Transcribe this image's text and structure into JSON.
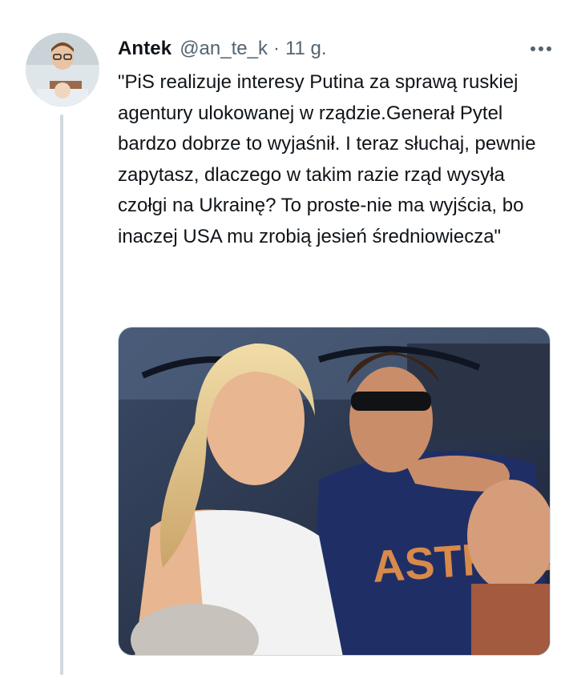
{
  "tweet": {
    "author_name": "Antek",
    "author_handle": "@an_te_k",
    "separator": "·",
    "timestamp": "11 g.",
    "text": "\"PiS realizuje interesy Putina za sprawą ruskiej agentury ulokowanej w rządzie.Generał Pytel bardzo dobrze to wyjaśnił. I teraz słuchaj, pewnie zapytasz, dlaczego w takim razie rząd wysyła czołgi na Ukrainę? To proste-nie ma wyjścia, bo inaczej USA mu zrobią jesień średniowiecza\"",
    "more_icon": "more-horizontal-icon",
    "media": {
      "description_icon": "photo",
      "shirt_text": "ASTROS"
    }
  },
  "colors": {
    "text": "#0f1419",
    "secondary": "#536471",
    "thread_line": "#cfd9de"
  }
}
